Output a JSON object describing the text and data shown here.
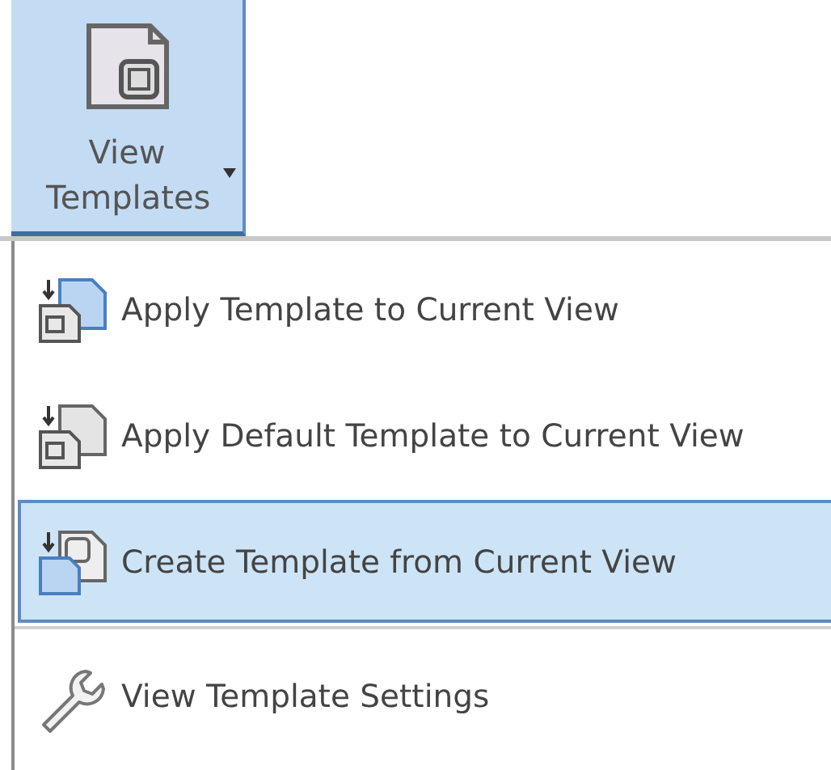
{
  "ribbon_button": {
    "label": "View Templates",
    "selected": true
  },
  "menu": {
    "groups": [
      {
        "items": [
          {
            "kind": "apply",
            "label": "Apply Template to Current View",
            "selected": false
          },
          {
            "kind": "apply-default",
            "label": "Apply Default Template to Current View",
            "selected": false
          },
          {
            "kind": "create",
            "label": "Create Template from Current View",
            "selected": true
          }
        ]
      },
      {
        "items": [
          {
            "kind": "settings",
            "label": "View Template Settings",
            "selected": false
          }
        ]
      }
    ]
  }
}
